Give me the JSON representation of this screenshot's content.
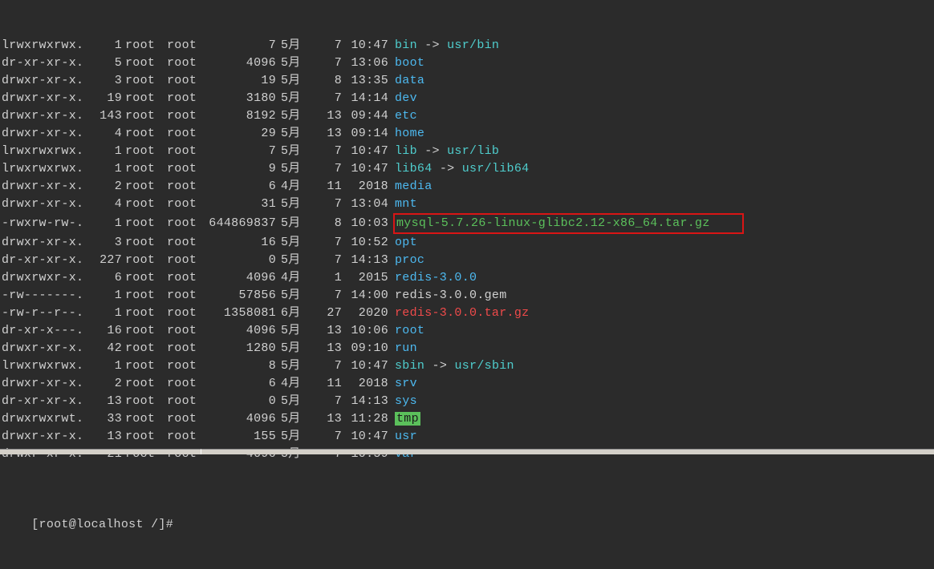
{
  "rows": [
    {
      "perms": "lrwxrwxrwx.",
      "links": "1",
      "owner": "root",
      "group": "root",
      "size": "7",
      "month": "5月",
      "day": "7",
      "time": "10:47",
      "name": "bin",
      "type": "link",
      "target": "usr/bin"
    },
    {
      "perms": "dr-xr-xr-x.",
      "links": "5",
      "owner": "root",
      "group": "root",
      "size": "4096",
      "month": "5月",
      "day": "7",
      "time": "13:06",
      "name": "boot",
      "type": "dir"
    },
    {
      "perms": "drwxr-xr-x.",
      "links": "3",
      "owner": "root",
      "group": "root",
      "size": "19",
      "month": "5月",
      "day": "8",
      "time": "13:35",
      "name": "data",
      "type": "dir"
    },
    {
      "perms": "drwxr-xr-x.",
      "links": "19",
      "owner": "root",
      "group": "root",
      "size": "3180",
      "month": "5月",
      "day": "7",
      "time": "14:14",
      "name": "dev",
      "type": "dir"
    },
    {
      "perms": "drwxr-xr-x.",
      "links": "143",
      "owner": "root",
      "group": "root",
      "size": "8192",
      "month": "5月",
      "day": "13",
      "time": "09:44",
      "name": "etc",
      "type": "dir"
    },
    {
      "perms": "drwxr-xr-x.",
      "links": "4",
      "owner": "root",
      "group": "root",
      "size": "29",
      "month": "5月",
      "day": "13",
      "time": "09:14",
      "name": "home",
      "type": "dir"
    },
    {
      "perms": "lrwxrwxrwx.",
      "links": "1",
      "owner": "root",
      "group": "root",
      "size": "7",
      "month": "5月",
      "day": "7",
      "time": "10:47",
      "name": "lib",
      "type": "link",
      "target": "usr/lib"
    },
    {
      "perms": "lrwxrwxrwx.",
      "links": "1",
      "owner": "root",
      "group": "root",
      "size": "9",
      "month": "5月",
      "day": "7",
      "time": "10:47",
      "name": "lib64",
      "type": "link",
      "target": "usr/lib64"
    },
    {
      "perms": "drwxr-xr-x.",
      "links": "2",
      "owner": "root",
      "group": "root",
      "size": "6",
      "month": "4月",
      "day": "11",
      "time": "2018",
      "name": "media",
      "type": "dir"
    },
    {
      "perms": "drwxr-xr-x.",
      "links": "4",
      "owner": "root",
      "group": "root",
      "size": "31",
      "month": "5月",
      "day": "7",
      "time": "13:04",
      "name": "mnt",
      "type": "dir"
    },
    {
      "perms": "-rwxrw-rw-.",
      "links": "1",
      "owner": "root",
      "group": "root",
      "size": "644869837",
      "month": "5月",
      "day": "8",
      "time": "10:03",
      "name": "mysql-5.7.26-linux-glibc2.12-x86_64.tar.gz",
      "type": "exec-boxed"
    },
    {
      "perms": "drwxr-xr-x.",
      "links": "3",
      "owner": "root",
      "group": "root",
      "size": "16",
      "month": "5月",
      "day": "7",
      "time": "10:52",
      "name": "opt",
      "type": "dir"
    },
    {
      "perms": "dr-xr-xr-x.",
      "links": "227",
      "owner": "root",
      "group": "root",
      "size": "0",
      "month": "5月",
      "day": "7",
      "time": "14:13",
      "name": "proc",
      "type": "dir"
    },
    {
      "perms": "drwxrwxr-x.",
      "links": "6",
      "owner": "root",
      "group": "root",
      "size": "4096",
      "month": "4月",
      "day": "1",
      "time": "2015",
      "name": "redis-3.0.0",
      "type": "dir"
    },
    {
      "perms": "-rw-------.",
      "links": "1",
      "owner": "root",
      "group": "root",
      "size": "57856",
      "month": "5月",
      "day": "7",
      "time": "14:00",
      "name": "redis-3.0.0.gem",
      "type": "plain"
    },
    {
      "perms": "-rw-r--r--.",
      "links": "1",
      "owner": "root",
      "group": "root",
      "size": "1358081",
      "month": "6月",
      "day": "27",
      "time": "2020",
      "name": "redis-3.0.0.tar.gz",
      "type": "archive"
    },
    {
      "perms": "dr-xr-x---.",
      "links": "16",
      "owner": "root",
      "group": "root",
      "size": "4096",
      "month": "5月",
      "day": "13",
      "time": "10:06",
      "name": "root",
      "type": "dir"
    },
    {
      "perms": "drwxr-xr-x.",
      "links": "42",
      "owner": "root",
      "group": "root",
      "size": "1280",
      "month": "5月",
      "day": "13",
      "time": "09:10",
      "name": "run",
      "type": "dir"
    },
    {
      "perms": "lrwxrwxrwx.",
      "links": "1",
      "owner": "root",
      "group": "root",
      "size": "8",
      "month": "5月",
      "day": "7",
      "time": "10:47",
      "name": "sbin",
      "type": "link",
      "target": "usr/sbin"
    },
    {
      "perms": "drwxr-xr-x.",
      "links": "2",
      "owner": "root",
      "group": "root",
      "size": "6",
      "month": "4月",
      "day": "11",
      "time": "2018",
      "name": "srv",
      "type": "dir"
    },
    {
      "perms": "dr-xr-xr-x.",
      "links": "13",
      "owner": "root",
      "group": "root",
      "size": "0",
      "month": "5月",
      "day": "7",
      "time": "14:13",
      "name": "sys",
      "type": "dir"
    },
    {
      "perms": "drwxrwxrwt.",
      "links": "33",
      "owner": "root",
      "group": "root",
      "size": "4096",
      "month": "5月",
      "day": "13",
      "time": "11:28",
      "name": "tmp",
      "type": "sticky"
    },
    {
      "perms": "drwxr-xr-x.",
      "links": "13",
      "owner": "root",
      "group": "root",
      "size": "155",
      "month": "5月",
      "day": "7",
      "time": "10:47",
      "name": "usr",
      "type": "dir"
    },
    {
      "perms": "drwxr-xr-x.",
      "links": "21",
      "owner": "root",
      "group": "root",
      "size": "4096",
      "month": "5月",
      "day": "7",
      "time": "10:59",
      "name": "var",
      "type": "dir"
    }
  ],
  "prompt": {
    "open": "[",
    "userhost": "root@localhost",
    "cwd": "/",
    "close": "]",
    "symbol": "#"
  },
  "arrow_text": " -> "
}
